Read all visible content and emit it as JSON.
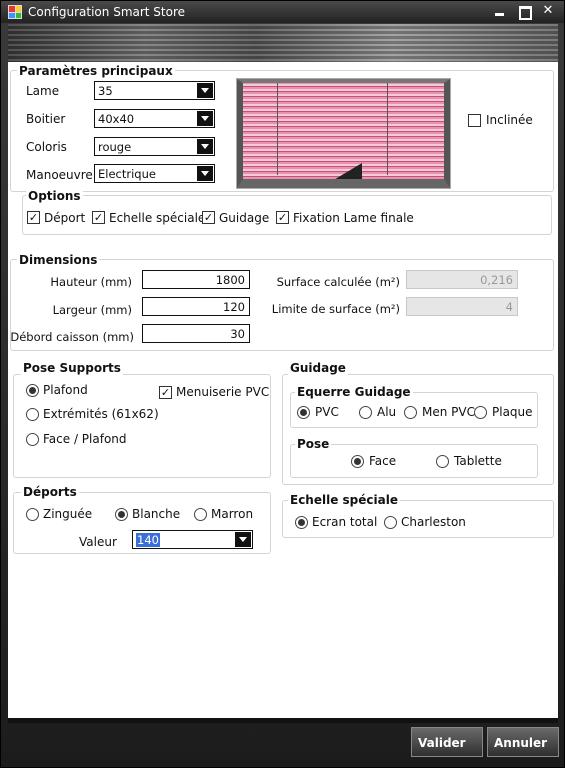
{
  "window": {
    "title": "Configuration Smart Store"
  },
  "parametres": {
    "title": "Paramètres principaux",
    "lame_label": "Lame",
    "lame_value": "35",
    "boitier_label": "Boitier",
    "boitier_value": "40x40",
    "coloris_label": "Coloris",
    "coloris_value": "rouge",
    "manoeuvre_label": "Manoeuvre",
    "manoeuvre_value": "Electrique",
    "inclinee_label": "Inclinée",
    "inclinee_checked": false
  },
  "options": {
    "title": "Options",
    "items": [
      {
        "label": "Déport",
        "checked": true
      },
      {
        "label": "Echelle spéciale",
        "checked": true
      },
      {
        "label": "Guidage",
        "checked": true
      },
      {
        "label": "Fixation Lame finale",
        "checked": true
      }
    ]
  },
  "dimensions": {
    "title": "Dimensions",
    "hauteur_label": "Hauteur (mm)",
    "hauteur_value": "1800",
    "largeur_label": "Largeur (mm)",
    "largeur_value": "120",
    "debord_label": "Débord caisson (mm)",
    "debord_value": "30",
    "surface_label": "Surface calculée (m²)",
    "surface_value": "0,216",
    "limite_label": "Limite de surface (m²)",
    "limite_value": "4"
  },
  "pose_supports": {
    "title": "Pose Supports",
    "options": [
      "Plafond",
      "Extrémités (61x62)",
      "Face / Plafond"
    ],
    "selected": "Plafond",
    "menuiserie_label": "Menuiserie PVC",
    "menuiserie_checked": true
  },
  "guidage": {
    "title": "Guidage",
    "equerre_title": "Equerre Guidage",
    "equerre_options": [
      "PVC",
      "Alu",
      "Men PVC",
      "Plaque"
    ],
    "equerre_selected": "PVC",
    "pose_title": "Pose",
    "pose_options": [
      "Face",
      "Tablette"
    ],
    "pose_selected": "Face"
  },
  "deports": {
    "title": "Déports",
    "options": [
      "Zinguée",
      "Blanche",
      "Marron"
    ],
    "selected": "Blanche",
    "valeur_label": "Valeur",
    "valeur_value": "140"
  },
  "echelle": {
    "title": "Echelle spéciale",
    "options": [
      "Ecran total",
      "Charleston"
    ],
    "selected": "Ecran total"
  },
  "buttons": {
    "valider": "Valider",
    "annuler": "Annuler"
  },
  "icons": {
    "checked": "check-icon",
    "dropdown": "chevron-down-icon"
  }
}
